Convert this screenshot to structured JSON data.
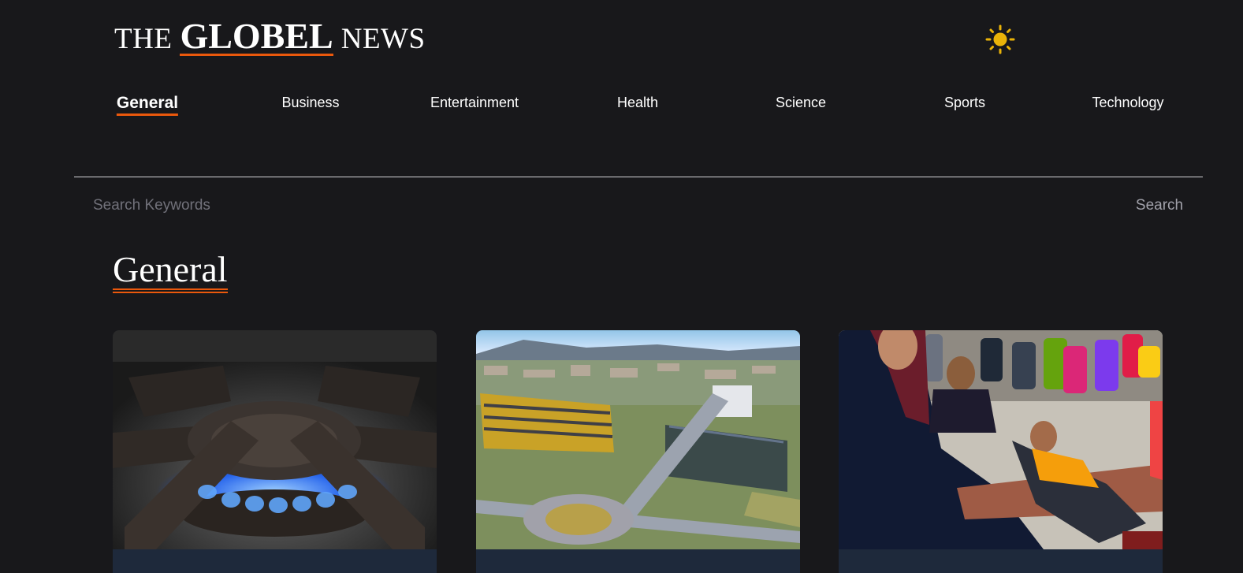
{
  "header": {
    "logo_prefix": "THE",
    "logo_brand": "GLOBEL",
    "logo_suffix": "NEWS",
    "theme_icon": "sun-icon"
  },
  "nav": {
    "items": [
      {
        "label": "General",
        "active": true
      },
      {
        "label": "Business"
      },
      {
        "label": "Entertainment"
      },
      {
        "label": "Health"
      },
      {
        "label": "Science"
      },
      {
        "label": "Sports"
      },
      {
        "label": "Technology"
      }
    ]
  },
  "search": {
    "placeholder": "Search Keywords",
    "button_label": "Search"
  },
  "section": {
    "title": "General"
  },
  "cards": [
    {
      "image": "gas-stove-burner-photo"
    },
    {
      "image": "aerial-town-roundabout-photo"
    },
    {
      "image": "refugee-family-tent-photo"
    }
  ],
  "colors": {
    "background": "#18181b",
    "accent": "#ea580c",
    "sun": "#eab308",
    "card_body": "#1e293b"
  }
}
